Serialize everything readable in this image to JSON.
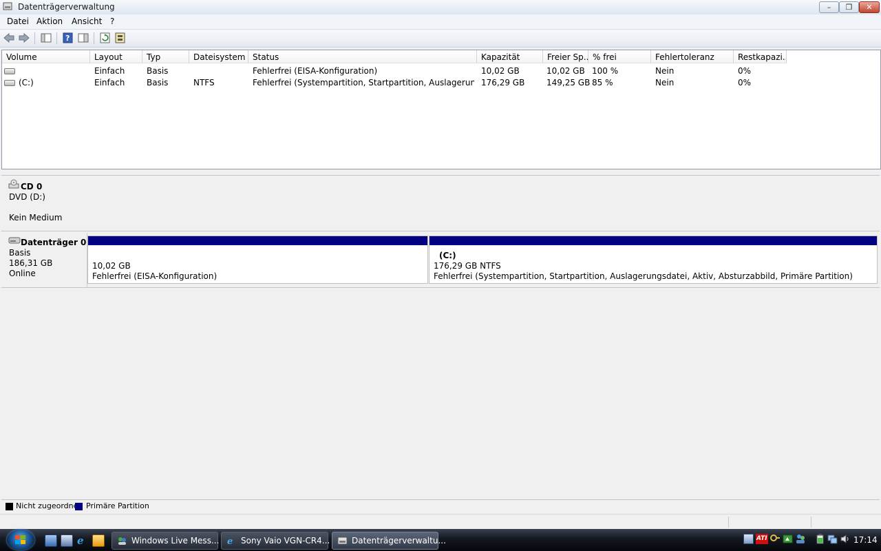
{
  "window": {
    "title": "Datenträgerverwaltung",
    "minimize_label": "–",
    "maximize_label": "❐",
    "close_label": "✕"
  },
  "menu": [
    "Datei",
    "Aktion",
    "Ansicht",
    "?"
  ],
  "columns": [
    "Volume",
    "Layout",
    "Typ",
    "Dateisystem",
    "Status",
    "Kapazität",
    "Freier Sp...",
    "% frei",
    "Fehlertoleranz",
    "Restkapazi..."
  ],
  "volumes": [
    {
      "volume": "",
      "layout": "Einfach",
      "typ": "Basis",
      "dateisystem": "",
      "status": "Fehlerfrei (EISA-Konfiguration)",
      "kapazitaet": "10,02 GB",
      "frei": "10,02 GB",
      "prozent_frei": "100 %",
      "fehlertoleranz": "Nein",
      "rest": "0%"
    },
    {
      "volume": "(C:)",
      "layout": "Einfach",
      "typ": "Basis",
      "dateisystem": "NTFS",
      "status": "Fehlerfrei (Systempartition, Startpartition, Auslagerungsdat...",
      "kapazitaet": "176,29 GB",
      "frei": "149,25 GB",
      "prozent_frei": "85 %",
      "fehlertoleranz": "Nein",
      "rest": "0%"
    }
  ],
  "cd": {
    "name": "CD 0",
    "type": "DVD (D:)",
    "status": "Kein Medium"
  },
  "disk0": {
    "name": "Datenträger 0",
    "type": "Basis",
    "size": "186,31 GB",
    "status": "Online",
    "partitions": [
      {
        "label": "",
        "size": "10,02 GB",
        "status": "Fehlerfrei (EISA-Konfiguration)"
      },
      {
        "label": "(C:)",
        "size": "176,29 GB NTFS",
        "status": "Fehlerfrei (Systempartition, Startpartition, Auslagerungsdatei, Aktiv, Absturzabbild, Primäre Partition)"
      }
    ]
  },
  "legend": [
    {
      "label": "Nicht zugeordnet",
      "color": "#000000"
    },
    {
      "label": "Primäre Partition",
      "color": "#000080"
    }
  ],
  "taskbar": {
    "buttons": [
      {
        "label": "Windows Live Mess...",
        "icon": "messenger-icon"
      },
      {
        "label": "Sony Vaio VGN-CR4...",
        "icon": "ie-icon"
      },
      {
        "label": "Datenträgerverwaltu...",
        "icon": "disk-management-icon",
        "active": true
      }
    ],
    "tray_icons": [
      "network-icon",
      "ati-icon",
      "key-icon",
      "wifi-icon",
      "people-icon",
      "battery-icon",
      "network-status-icon",
      "volume-icon"
    ],
    "ati_label": "ATI",
    "clock": "17:14"
  }
}
